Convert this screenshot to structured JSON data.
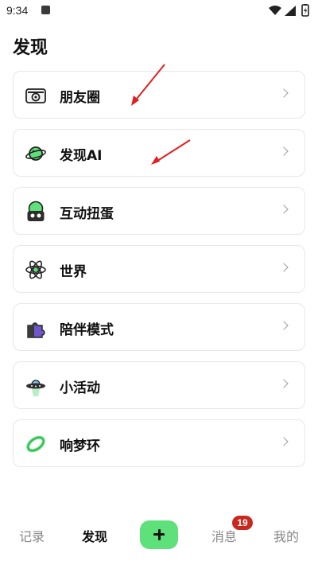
{
  "status_bar": {
    "time": "9:34"
  },
  "page": {
    "title": "发现"
  },
  "menu": [
    {
      "label": "朋友圈",
      "icon": "camera-icon"
    },
    {
      "label": "发现AI",
      "icon": "planet-icon"
    },
    {
      "label": "互动扭蛋",
      "icon": "gashapon-icon"
    },
    {
      "label": "世界",
      "icon": "atom-icon"
    },
    {
      "label": "陪伴模式",
      "icon": "puzzle-icon"
    },
    {
      "label": "小活动",
      "icon": "ufo-icon"
    },
    {
      "label": "响梦环",
      "icon": "ring-icon"
    }
  ],
  "tab_bar": {
    "record": "记录",
    "discover": "发现",
    "message": "消息",
    "mine": "我的",
    "message_badge": "19",
    "active": "discover"
  },
  "colors": {
    "accent": "#5ee07a",
    "badge": "#c8281e",
    "arrow": "#e02020"
  }
}
